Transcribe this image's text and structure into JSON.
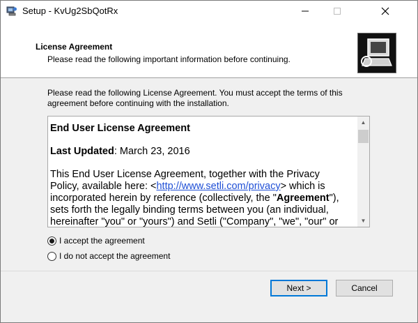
{
  "window": {
    "title": "Setup - KvUg2SbQotRx",
    "icon": "setup-computer-icon"
  },
  "header": {
    "title": "License Agreement",
    "subtitle": "Please read the following important information before continuing.",
    "logo_icon": "computer-logo-icon"
  },
  "intro": "Please read the following License Agreement. You must accept the terms of this agreement before continuing with the installation.",
  "license": {
    "heading": "End User License Agreement",
    "updated_label": "Last Updated",
    "updated_value": ": March 23, 2016",
    "p1_a": "This End User License Agreement, together with the Privacy Policy, available here: <",
    "p1_link": "http://www.setli.com/privacy",
    "p1_b": "> which is incorporated herein by reference (collectively, the \"",
    "p1_bold": "Agreement",
    "p1_c": "\"), sets forth the legally binding terms between you (an individual, hereinafter \"you\" or \"yours\") and Setli (\"Company\", \"we\", \"our\" or"
  },
  "options": {
    "accept": "I accept the agreement",
    "decline": "I do not accept the agreement",
    "selected": "accept"
  },
  "buttons": {
    "next": "Next >",
    "cancel": "Cancel"
  }
}
